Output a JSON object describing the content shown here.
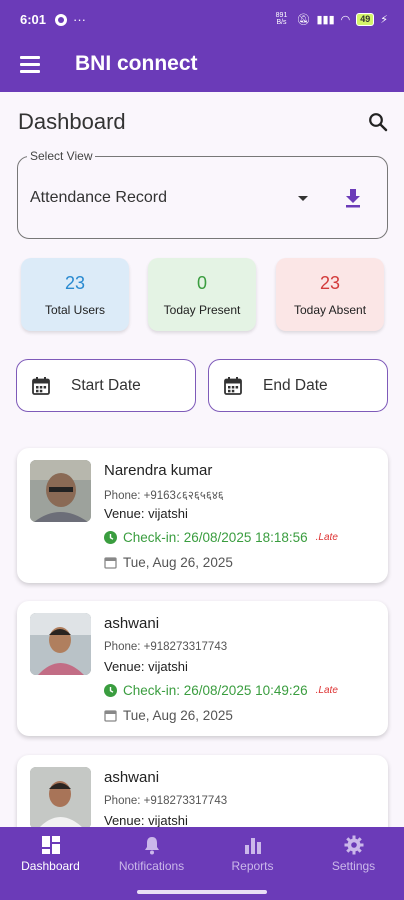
{
  "status_bar": {
    "time": "6:01",
    "net_speed": "891 B/s"
  },
  "app_bar": {
    "title": "BNI connect"
  },
  "page": {
    "title": "Dashboard"
  },
  "select_view": {
    "label": "Select View",
    "value": "Attendance Record"
  },
  "stats": [
    {
      "value": "23",
      "label": "Total Users",
      "bg": "#dcebf8",
      "color": "#2a8ad0"
    },
    {
      "value": "0",
      "label": "Today Present",
      "bg": "#e4f3e4",
      "color": "#3a9d3f"
    },
    {
      "value": "23",
      "label": "Today Absent",
      "bg": "#fbe6e6",
      "color": "#d33b3b"
    }
  ],
  "filters": {
    "start_date": "Start Date",
    "end_date": "End Date"
  },
  "records": [
    {
      "name": "Narendra kumar",
      "phone": "Phone: +9163८६२६५६४६",
      "venue": "Venue: vijatshi",
      "checkin": "Check-in: 26/08/2025 18:18:56",
      "status": ".Late",
      "date": "Tue, Aug 26, 2025"
    },
    {
      "name": "ashwani",
      "phone": "Phone: +918273317743",
      "venue": "Venue: vijatshi",
      "checkin": "Check-in: 26/08/2025 10:49:26",
      "status": ".Late",
      "date": "Tue, Aug 26, 2025"
    },
    {
      "name": "ashwani",
      "phone": "Phone: +918273317743",
      "venue": "Venue: vijatshi"
    }
  ],
  "nav": [
    {
      "label": "Dashboard",
      "icon": "dashboard-icon"
    },
    {
      "label": "Notifications",
      "icon": "bell-icon"
    },
    {
      "label": "Reports",
      "icon": "bar-chart-icon"
    },
    {
      "label": "Settings",
      "icon": "gear-icon"
    }
  ],
  "colors": {
    "primary": "#6b3bb8",
    "late": "#dd3333",
    "checkin": "#3a9d3f"
  }
}
